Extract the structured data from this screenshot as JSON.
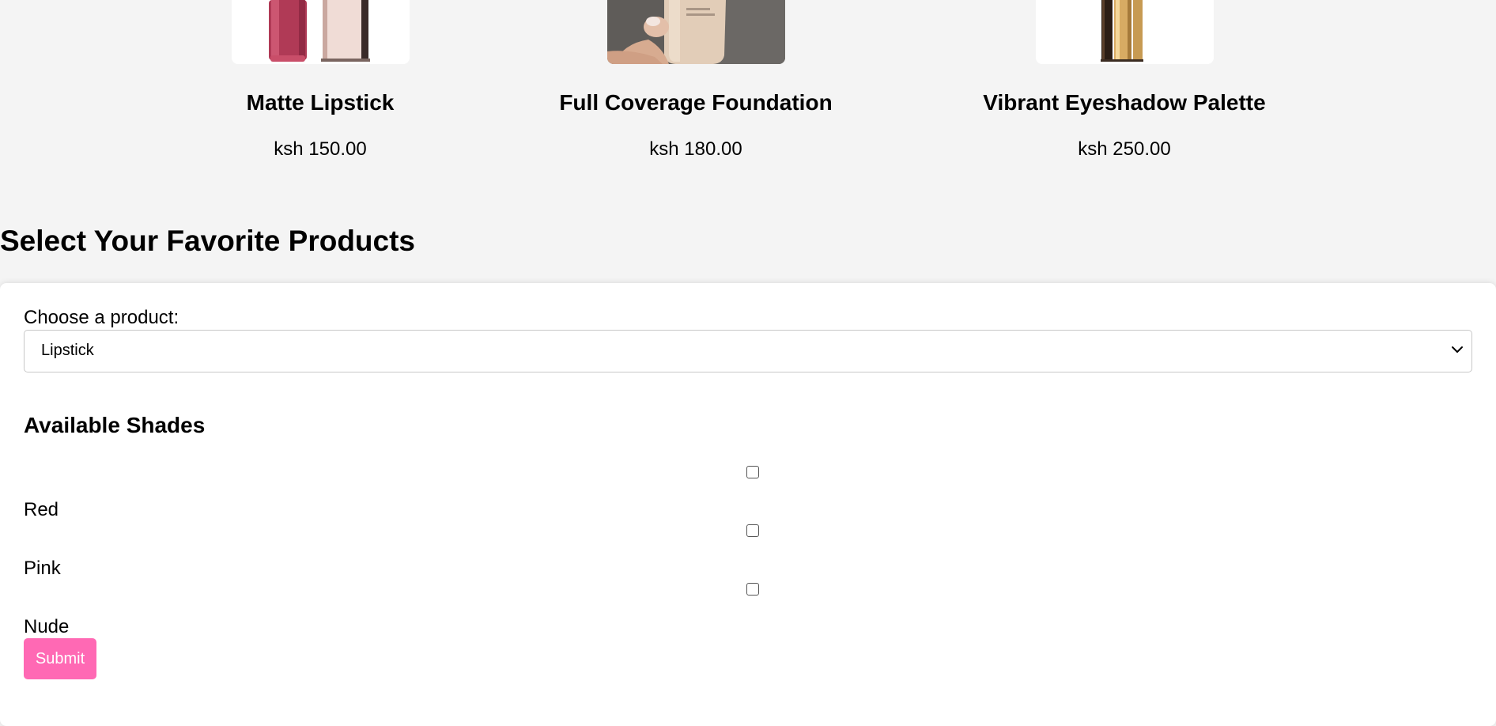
{
  "products": [
    {
      "name": "Matte Lipstick",
      "price": "ksh 150.00",
      "image": "lip-gloss-tubes-image"
    },
    {
      "name": "Full Coverage Foundation",
      "price": "ksh 180.00",
      "image": "foundation-bottle-image"
    },
    {
      "name": "Vibrant Eyeshadow Palette",
      "price": "ksh 250.00",
      "image": "gold-lipstick-image"
    }
  ],
  "section_title": "Select Your Favorite Products",
  "form": {
    "choose_label": "Choose a product:",
    "selected_product": "Lipstick",
    "shades_title": "Available Shades",
    "shades": [
      {
        "label": "Red",
        "checked": false
      },
      {
        "label": "Pink",
        "checked": false
      },
      {
        "label": "Nude",
        "checked": false
      }
    ],
    "submit_label": "Submit"
  },
  "colors": {
    "page_bg": "#f4f4f4",
    "card_bg": "#ffffff",
    "button_bg": "#ff69b4",
    "button_text": "#ffffff"
  }
}
